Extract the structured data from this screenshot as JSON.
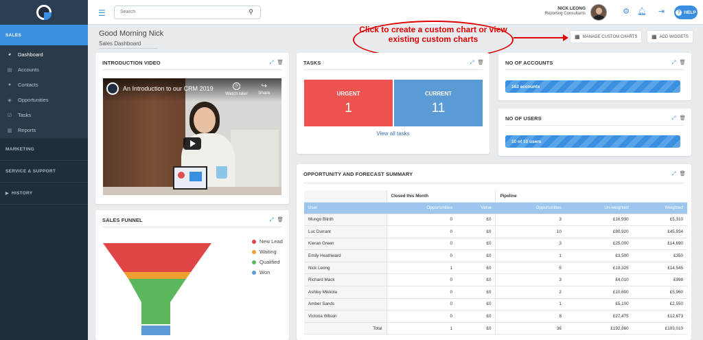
{
  "sidebar": {
    "sections": {
      "sales": "SALES",
      "marketing": "MARKETING",
      "service": "SERVICE & SUPPORT",
      "history": "HISTORY"
    },
    "items": [
      {
        "label": "Dashboard",
        "icon": "dashboard-icon"
      },
      {
        "label": "Accounts",
        "icon": "building-icon"
      },
      {
        "label": "Contacts",
        "icon": "users-icon"
      },
      {
        "label": "Opportunities",
        "icon": "money-icon"
      },
      {
        "label": "Tasks",
        "icon": "tasks-icon"
      },
      {
        "label": "Reports",
        "icon": "reports-icon"
      }
    ]
  },
  "topbar": {
    "search_placeholder": "Search",
    "user_name": "NICK LEONG",
    "user_role": "Reporting Consultants",
    "help_label": "HELP"
  },
  "header": {
    "greeting": "Good Morning Nick",
    "subtitle": "Sales Dashboard",
    "manage_charts": "MANAGE CUSTOM CHARTS",
    "add_widgets": "ADD WIDGETS"
  },
  "callout": {
    "text": "Click to create a custom chart or view existing custom charts",
    "color": "#e00000"
  },
  "intro_video": {
    "title": "INTRODUCTION VIDEO",
    "video_title": "An Introduction to our CRM 2019",
    "watch_later": "Watch later",
    "share": "Share"
  },
  "sales_funnel": {
    "title": "SALES FUNNEL",
    "legend": [
      {
        "label": "New Lead",
        "color": "#e04545"
      },
      {
        "label": "Waiting",
        "color": "#f0a030"
      },
      {
        "label": "Qualified",
        "color": "#5cb85c"
      },
      {
        "label": "Won",
        "color": "#5b9bd5"
      }
    ]
  },
  "tasks": {
    "title": "TASKS",
    "urgent_label": "URGENT",
    "urgent_value": "1",
    "current_label": "CURRENT",
    "current_value": "11",
    "view_all": "View all tasks"
  },
  "accounts": {
    "title": "NO OF ACCOUNTS",
    "bar_text": "162 accounts"
  },
  "users": {
    "title": "NO OF USERS",
    "bar_text": "10 of 10 users"
  },
  "opportunity": {
    "title": "OPPORTUNITY AND FORECAST SUMMARY",
    "group_month": "Closed this Month",
    "group_pipeline": "Pipeline",
    "columns": [
      "User",
      "Opportunities",
      "Value",
      "Opportunities",
      "Un-weighted",
      "Weighted"
    ],
    "rows": [
      [
        "Mungo Blinth",
        "0",
        "£0",
        "3",
        "£16,930",
        "£5,310"
      ],
      [
        "Luc Durrant",
        "0",
        "£0",
        "10",
        "£80,920",
        "£45,934"
      ],
      [
        "Kieran Green",
        "0",
        "£0",
        "3",
        "£25,000",
        "£14,690"
      ],
      [
        "Emily Heathward",
        "0",
        "£0",
        "1",
        "£3,500",
        "£350"
      ],
      [
        "Nick Leong",
        "1",
        "£0",
        "5",
        "£19,325",
        "£14,545"
      ],
      [
        "Richard Mack",
        "0",
        "£0",
        "3",
        "£4,010",
        "£998"
      ],
      [
        "Ashley Mikkola",
        "0",
        "£0",
        "2",
        "£10,600",
        "£5,960"
      ],
      [
        "Amber Sands",
        "0",
        "£0",
        "1",
        "£5,100",
        "£2,550"
      ],
      [
        "Victoria Wilson",
        "0",
        "£0",
        "8",
        "£27,475",
        "£12,673"
      ]
    ],
    "total": [
      "Total",
      "1",
      "£0",
      "36",
      "£192,860",
      "£103,010"
    ]
  },
  "colors": {
    "accent": "#3a8fe0",
    "urgent": "#ef5350",
    "current": "#5b9bd5",
    "sidebar": "#1f2d3d"
  }
}
